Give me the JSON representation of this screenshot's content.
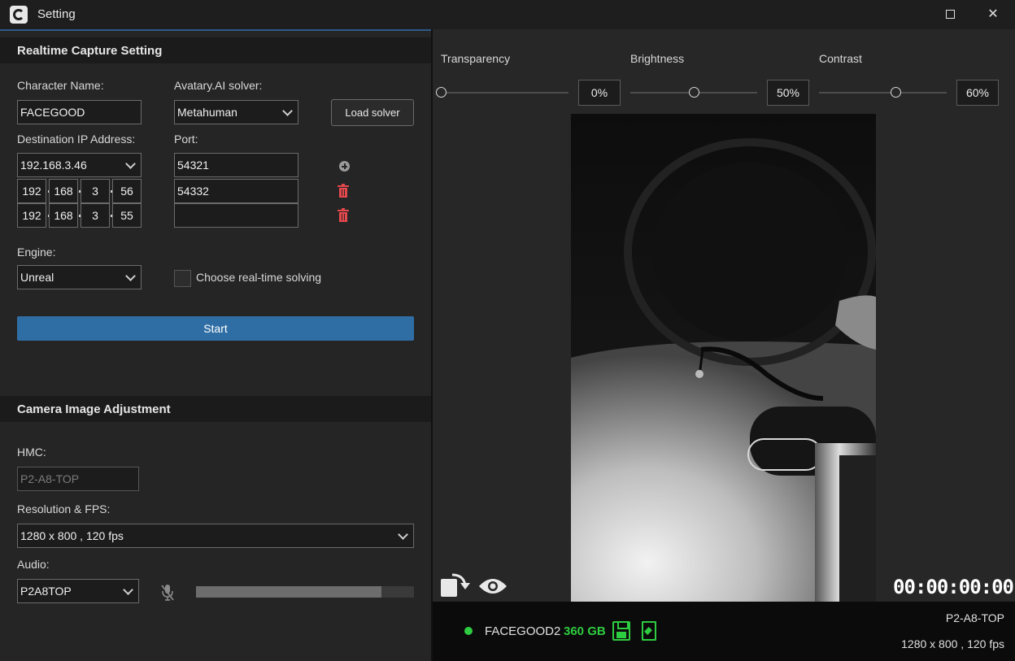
{
  "window": {
    "title": "Setting",
    "maximize_icon": "maximize-icon",
    "close_icon": "close-icon",
    "close_glyph": "✕"
  },
  "capture": {
    "section_title": "Realtime Capture Setting",
    "character_name_label": "Character Name:",
    "character_name_value": "FACEGOOD",
    "solver_label": "Avatary.AI solver:",
    "solver_value": "Metahuman",
    "load_solver_label": "Load solver",
    "dest_ip_label": "Destination IP Address:",
    "port_label": "Port:",
    "ip_primary": "192.168.3.46",
    "port_primary": "54321",
    "ip_rows": [
      {
        "o1": "192",
        "o2": "168",
        "o3": "3",
        "o4": "56",
        "port": "54332"
      },
      {
        "o1": "192",
        "o2": "168",
        "o3": "3",
        "o4": "55",
        "port": ""
      }
    ],
    "engine_label": "Engine:",
    "engine_value": "Unreal",
    "realtime_label": "Choose real-time solving",
    "realtime_checked": false,
    "start_label": "Start"
  },
  "camera": {
    "section_title": "Camera Image Adjustment",
    "hmc_label": "HMC:",
    "hmc_placeholder": "P2-A8-TOP",
    "resolution_label": "Resolution & FPS:",
    "resolution_value": "1280 x 800 , 120 fps",
    "audio_label": "Audio:",
    "audio_value": "P2A8TOP",
    "audio_level": 0.85
  },
  "adjust": {
    "transparency_label": "Transparency",
    "transparency_value": "0%",
    "transparency_level": 0.0,
    "brightness_label": "Brightness",
    "brightness_value": "50%",
    "brightness_level": 0.5,
    "contrast_label": "Contrast",
    "contrast_value": "60%",
    "contrast_level": 0.6
  },
  "preview": {
    "timecode": "00:00:00:00"
  },
  "status": {
    "device": "FACEGOOD2",
    "storage": "360 GB",
    "hmc": "P2-A8-TOP",
    "resolution": "1280 x 800 , 120 fps",
    "accent_color": "#2ecc40"
  }
}
